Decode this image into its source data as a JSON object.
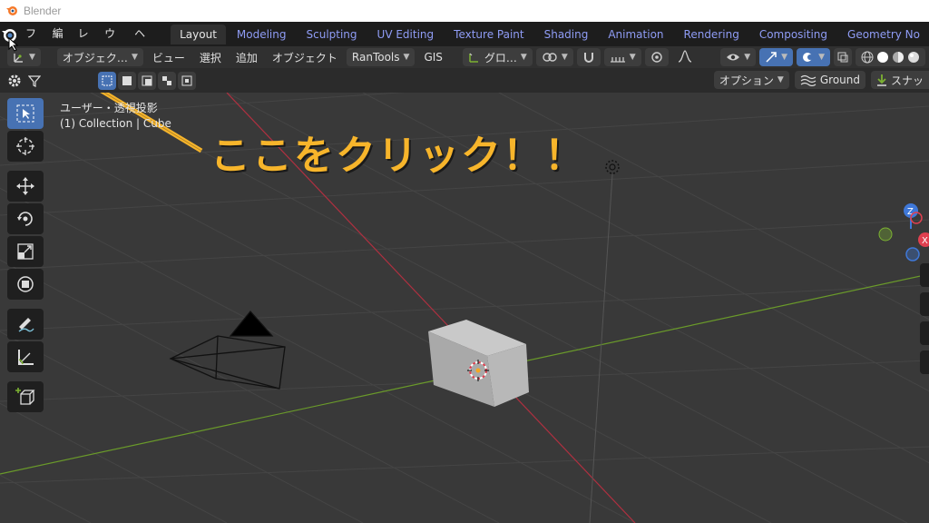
{
  "window": {
    "title": "Blender"
  },
  "menu": [
    "ファイル",
    "編集",
    "レンダー",
    "ウィンドウ",
    "ヘルプ"
  ],
  "workspaces": [
    {
      "label": "Layout",
      "active": true
    },
    {
      "label": "Modeling"
    },
    {
      "label": "Sculpting"
    },
    {
      "label": "UV Editing"
    },
    {
      "label": "Texture Paint"
    },
    {
      "label": "Shading"
    },
    {
      "label": "Animation"
    },
    {
      "label": "Rendering"
    },
    {
      "label": "Compositing"
    },
    {
      "label": "Geometry No"
    }
  ],
  "header": {
    "mode": "オブジェク…",
    "view": "ビュー",
    "select": "選択",
    "add": "追加",
    "object": "オブジェクト",
    "addon": "RanTools",
    "gis": "GIS",
    "transform": "グロ…"
  },
  "header2": {
    "options": "オプション",
    "ground": "Ground",
    "snap": "スナッ"
  },
  "viewport": {
    "view_label": "ユーザー・透視投影",
    "collection_label": "(1) Collection | Cube"
  },
  "annotation": {
    "text": "ここをクリック！！"
  },
  "colors": {
    "accent_tab": "#8f9cf5",
    "active_tool": "#4772b3",
    "annotation": "#f7b52b",
    "axis_x": "#e04050",
    "axis_y": "#7cb232",
    "axis_z": "#3f78d8"
  },
  "gizmo": {
    "z_label": "Z",
    "x_label": "X"
  }
}
